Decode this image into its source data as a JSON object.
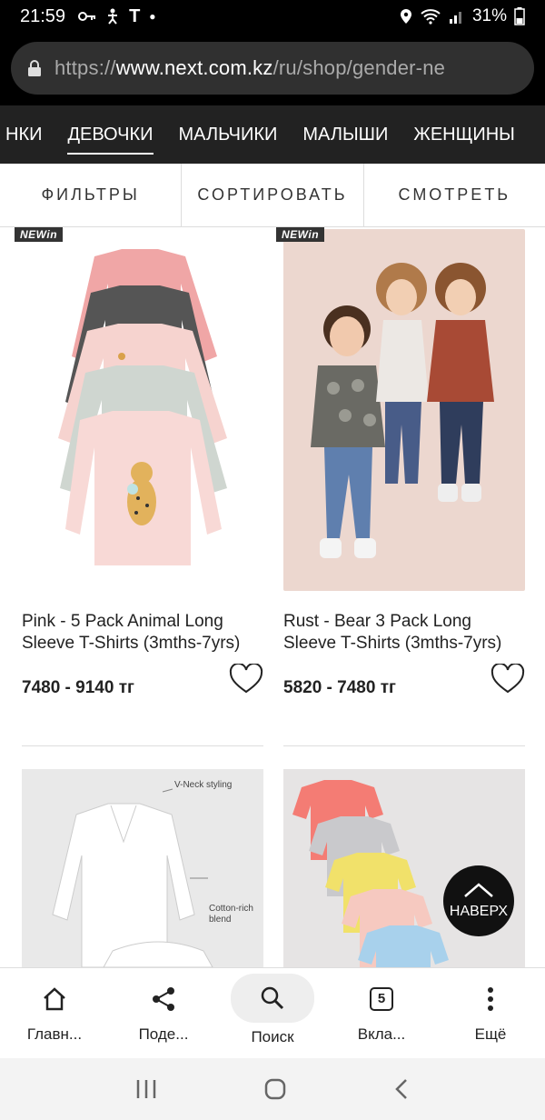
{
  "status_bar": {
    "time": "21:59",
    "battery": "31%",
    "t_icon": "T"
  },
  "browser": {
    "url_prefix": "https://",
    "url_host": "www.next.com.kz",
    "url_path": "/ru/shop/gender-ne"
  },
  "categories": [
    {
      "label": "НКИ"
    },
    {
      "label": "ДЕВОЧКИ",
      "active": true
    },
    {
      "label": "МАЛЬЧИКИ"
    },
    {
      "label": "МАЛЫШИ"
    },
    {
      "label": "ЖЕНЩИНЫ"
    }
  ],
  "filters": {
    "filter": "ФИЛЬТРЫ",
    "sort": "СОРТИРОВАТЬ",
    "view": "СМОТРЕТЬ"
  },
  "products": [
    {
      "badge": "NEWin",
      "title": "Pink - 5 Pack Animal Long Sleeve T-Shirts (3mths-7yrs)",
      "price": "7480 - 9140 тг"
    },
    {
      "badge": "NEWin",
      "title": "Rust - Bear 3 Pack Long Sleeve T-Shirts (3mths-7yrs)",
      "price": "5820 - 7480 тг"
    }
  ],
  "annotations": {
    "vneck": "V-Neck styling",
    "cotton_line1": "Cotton-rich",
    "cotton_line2": "blend"
  },
  "back_to_top": "НАВЕРХ",
  "toolbar": {
    "home": "Главн...",
    "share": "Поде...",
    "search": "Поиск",
    "tabs": "Вкла...",
    "tabs_count": "5",
    "more": "Ещё"
  }
}
